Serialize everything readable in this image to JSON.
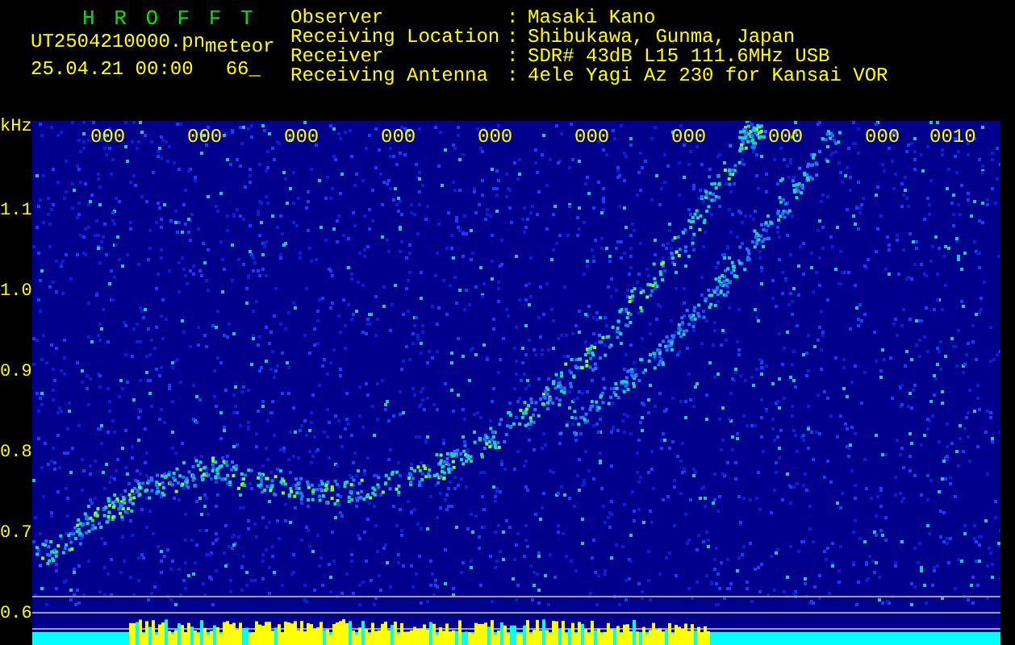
{
  "header": {
    "app_title": "H R O F F T",
    "file_name": "UT2504210000.pn",
    "mode": "meteor",
    "date_time": "25.04.21 00:00",
    "count": "66_"
  },
  "info": [
    {
      "label": "Observer",
      "value": "Masaki Kano"
    },
    {
      "label": "Receiving Location",
      "value": "Shibukawa, Gunma, Japan"
    },
    {
      "label": "Receiver",
      "value": "SDR# 43dB L15 111.6MHz USB"
    },
    {
      "label": "Receiving Antenna",
      "value": "4ele Yagi Az 230 for Kansai VOR"
    }
  ],
  "info_separator": ":",
  "spectrogram": {
    "unit": "kHz",
    "y_labels": [
      "1.1",
      "1.0",
      "0.9",
      "0.8",
      "0.7",
      "0.6"
    ],
    "time_labels": [
      "000",
      "000",
      "000",
      "000",
      "000",
      "000",
      "000",
      "000",
      "000",
      "0010"
    ]
  }
}
